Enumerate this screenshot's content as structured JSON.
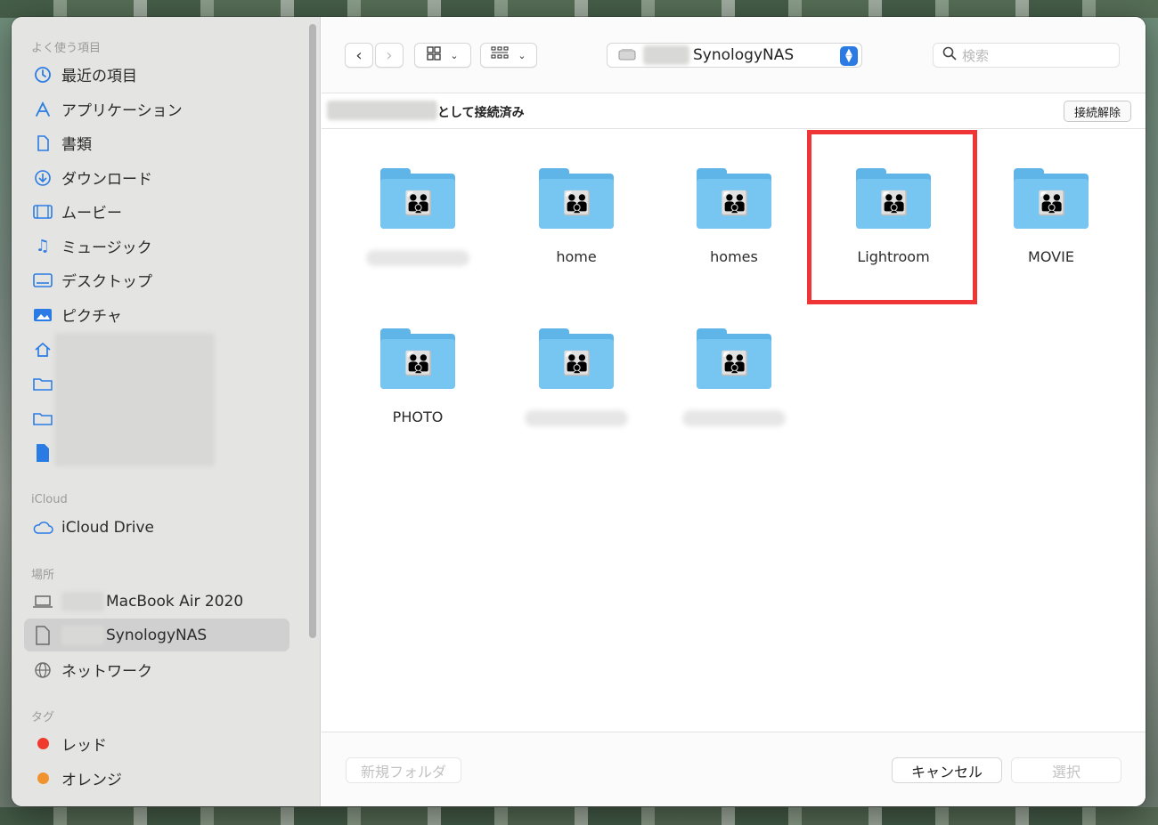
{
  "sidebar": {
    "favorites_title": "よく使う項目",
    "favorites": [
      {
        "label": "最近の項目",
        "icon": "clock-icon"
      },
      {
        "label": "アプリケーション",
        "icon": "apps-icon"
      },
      {
        "label": "書類",
        "icon": "document-icon"
      },
      {
        "label": "ダウンロード",
        "icon": "download-icon"
      },
      {
        "label": "ムービー",
        "icon": "film-icon"
      },
      {
        "label": "ミュージック",
        "icon": "music-icon"
      },
      {
        "label": "デスクトップ",
        "icon": "desktop-icon"
      },
      {
        "label": "ピクチャ",
        "icon": "photo-icon"
      }
    ],
    "icloud_title": "iCloud",
    "icloud_drive": "iCloud Drive",
    "places_title": "場所",
    "places": [
      {
        "label": "MacBook Air 2020",
        "icon": "laptop-icon"
      },
      {
        "label": "SynologyNAS",
        "icon": "server-icon"
      },
      {
        "label": "ネットワーク",
        "icon": "network-icon"
      }
    ],
    "tags_title": "タグ",
    "tags": [
      {
        "label": "レッド",
        "color": "#f03a2e"
      },
      {
        "label": "オレンジ",
        "color": "#f0932e"
      }
    ]
  },
  "toolbar": {
    "location": "SynologyNAS",
    "search_placeholder": "検索"
  },
  "connection": {
    "status": "として接続済み",
    "disconnect_label": "接続解除"
  },
  "folders": [
    {
      "name": ""
    },
    {
      "name": "home"
    },
    {
      "name": "homes"
    },
    {
      "name": "Lightroom"
    },
    {
      "name": "MOVIE"
    },
    {
      "name": "PHOTO"
    },
    {
      "name": ""
    },
    {
      "name": ""
    }
  ],
  "footer": {
    "new_folder_label": "新規フォルダ",
    "cancel_label": "キャンセル",
    "select_label": "選択"
  }
}
